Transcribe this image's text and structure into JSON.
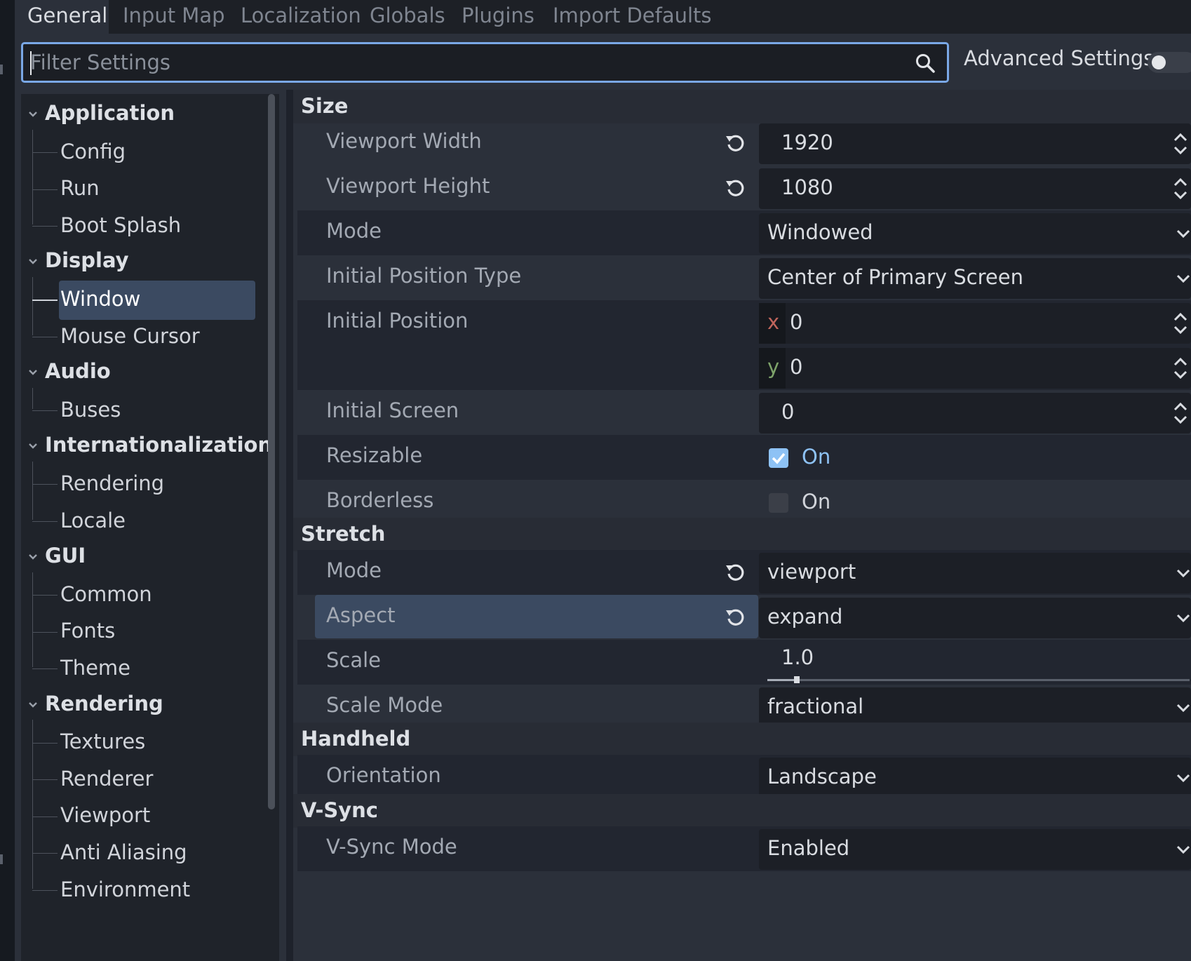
{
  "tabs": [
    {
      "label": "General",
      "active": true
    },
    {
      "label": "Input Map",
      "active": false
    },
    {
      "label": "Localization",
      "active": false
    },
    {
      "label": "Globals",
      "active": false
    },
    {
      "label": "Plugins",
      "active": false
    },
    {
      "label": "Import Defaults",
      "active": false
    }
  ],
  "filter": {
    "placeholder": "Filter Settings",
    "value": "",
    "icon": "search-icon"
  },
  "advanced": {
    "label": "Advanced Settings",
    "enabled": false
  },
  "colors": {
    "accent": "#7aa8e6",
    "selection": "#3b4a61",
    "checkbox_on": "#8ec2f5",
    "axis_x": "#c0655c",
    "axis_y": "#7ea36a"
  },
  "sidebar": {
    "sections": [
      {
        "label": "Application",
        "items": [
          "Config",
          "Run",
          "Boot Splash"
        ]
      },
      {
        "label": "Display",
        "items": [
          "Window",
          "Mouse Cursor"
        ]
      },
      {
        "label": "Audio",
        "items": [
          "Buses"
        ]
      },
      {
        "label": "Internationalization",
        "items": [
          "Rendering",
          "Locale"
        ]
      },
      {
        "label": "GUI",
        "items": [
          "Common",
          "Fonts",
          "Theme"
        ]
      },
      {
        "label": "Rendering",
        "items": [
          "Textures",
          "Renderer",
          "Viewport",
          "Anti Aliasing",
          "Environment"
        ]
      }
    ],
    "selected": "Window"
  },
  "inspector": {
    "groups": {
      "size": "Size",
      "stretch": "Stretch",
      "handheld": "Handheld",
      "vsync": "V-Sync"
    },
    "size": {
      "viewport_width": {
        "label": "Viewport Width",
        "value": "1920"
      },
      "viewport_height": {
        "label": "Viewport Height",
        "value": "1080"
      },
      "mode": {
        "label": "Mode",
        "value": "Windowed"
      },
      "initial_position_type": {
        "label": "Initial Position Type",
        "value": "Center of Primary Screen"
      },
      "initial_position": {
        "label": "Initial Position",
        "x_label": "x",
        "x": "0",
        "y_label": "y",
        "y": "0"
      },
      "initial_screen": {
        "label": "Initial Screen",
        "value": "0"
      },
      "resizable": {
        "label": "Resizable",
        "value": "On",
        "checked": true
      },
      "borderless": {
        "label": "Borderless",
        "value": "On",
        "checked": false
      }
    },
    "stretch": {
      "mode": {
        "label": "Mode",
        "value": "viewport"
      },
      "aspect": {
        "label": "Aspect",
        "value": "expand"
      },
      "scale": {
        "label": "Scale",
        "value": "1.0",
        "slider_fraction": 0.07
      },
      "scale_mode": {
        "label": "Scale Mode",
        "value": "fractional"
      }
    },
    "handheld": {
      "orientation": {
        "label": "Orientation",
        "value": "Landscape"
      }
    },
    "vsync": {
      "vsync_mode": {
        "label": "V-Sync Mode",
        "value": "Enabled"
      }
    }
  }
}
